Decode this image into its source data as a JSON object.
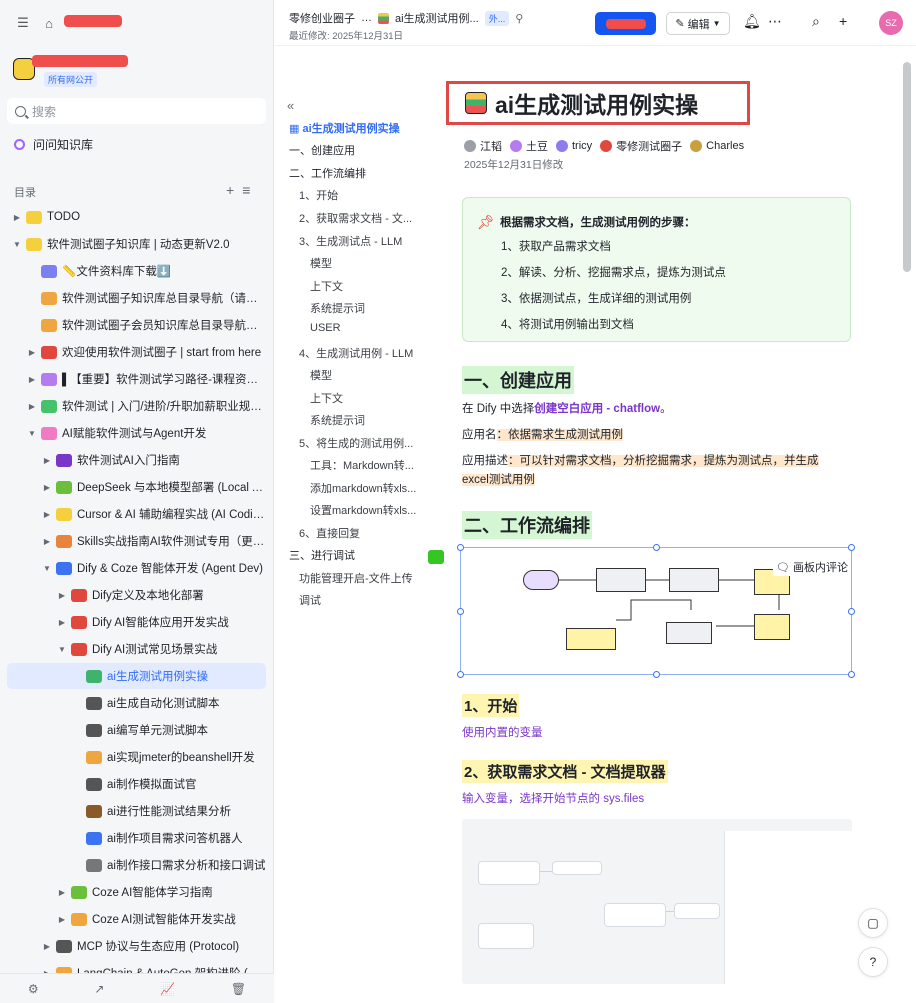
{
  "sidebar": {
    "kb_badge": "所有网公开",
    "search_placeholder": "搜索",
    "ask_label": "问问知识库",
    "toc_label": "目录",
    "tree": [
      {
        "label": "TODO",
        "arrow": "▶",
        "indent": 0,
        "icon_color": "#f4d03f"
      },
      {
        "label": "软件测试圈子知识库 | 动态更新V2.0",
        "arrow": "▼",
        "indent": 0,
        "icon_color": "#f4d03f"
      },
      {
        "label": "📏文件资料库下载⬇️",
        "arrow": "",
        "indent": 1,
        "icon_color": "#7b7ff0"
      },
      {
        "label": "软件测试圈子知识库总目录导航（请收藏...",
        "arrow": "",
        "indent": 1,
        "icon_color": "#f0a640"
      },
      {
        "label": "软件测试圈子会员知识库总目录导航（请...",
        "arrow": "",
        "indent": 1,
        "icon_color": "#f0a640"
      },
      {
        "label": "欢迎使用软件测试圈子 | start from here",
        "arrow": "▶",
        "indent": 1,
        "icon_color": "#e0483e"
      },
      {
        "label": "▌【重要】软件测试学习路径-课程资源下载",
        "arrow": "▶",
        "indent": 1,
        "icon_color": "#b57bf0"
      },
      {
        "label": "软件测试 | 入门/进阶/升职加薪职业规划（...",
        "arrow": "▶",
        "indent": 1,
        "icon_color": "#44c36b"
      },
      {
        "label": "AI赋能软件测试与Agent开发",
        "arrow": "▼",
        "indent": 1,
        "icon_color": "#f07bc4"
      },
      {
        "label": "软件测试AI入门指南",
        "arrow": "▶",
        "indent": 2,
        "icon_color": "#7a35c9"
      },
      {
        "label": "DeepSeek 与本地模型部署 (Local AI)",
        "arrow": "▶",
        "indent": 2,
        "icon_color": "#6cbf3c"
      },
      {
        "label": "Cursor & AI 辅助编程实战 (AI Coding)",
        "arrow": "▶",
        "indent": 2,
        "icon_color": "#f4d03f"
      },
      {
        "label": "Skills实战指南AI软件测试专用（更新中）",
        "arrow": "▶",
        "indent": 2,
        "icon_color": "#e8843c"
      },
      {
        "label": "Dify & Coze 智能体开发 (Agent Dev)",
        "arrow": "▼",
        "indent": 2,
        "icon_color": "#3b73f0"
      },
      {
        "label": "Dify定义及本地化部署",
        "arrow": "▶",
        "indent": 3,
        "icon_color": "#e0483e"
      },
      {
        "label": "Dify AI智能体应用开发实战",
        "arrow": "▶",
        "indent": 3,
        "icon_color": "#e0483e"
      },
      {
        "label": "Dify AI测试常见场景实战",
        "arrow": "▼",
        "indent": 3,
        "icon_color": "#e0483e"
      },
      {
        "label": "ai生成测试用例实操",
        "arrow": "",
        "indent": 4,
        "icon_color": "#3fb36b",
        "selected": true
      },
      {
        "label": "ai生成自动化测试脚本",
        "arrow": "",
        "indent": 4,
        "icon_color": "#555"
      },
      {
        "label": "ai编写单元测试脚本",
        "arrow": "",
        "indent": 4,
        "icon_color": "#555"
      },
      {
        "label": "ai实现jmeter的beanshell开发",
        "arrow": "",
        "indent": 4,
        "icon_color": "#f0a640"
      },
      {
        "label": "ai制作模拟面试官",
        "arrow": "",
        "indent": 4,
        "icon_color": "#555"
      },
      {
        "label": "ai进行性能测试结果分析",
        "arrow": "",
        "indent": 4,
        "icon_color": "#8a5a2b"
      },
      {
        "label": "ai制作项目需求问答机器人",
        "arrow": "",
        "indent": 4,
        "icon_color": "#3b73f0"
      },
      {
        "label": "ai制作接口需求分析和接口调试",
        "arrow": "",
        "indent": 4,
        "icon_color": "#777"
      },
      {
        "label": "Coze AI智能体学习指南",
        "arrow": "▶",
        "indent": 3,
        "icon_color": "#6cbf3c"
      },
      {
        "label": "Coze AI测试智能体开发实战",
        "arrow": "▶",
        "indent": 3,
        "icon_color": "#f0a640"
      },
      {
        "label": "MCP 协议与生态应用 (Protocol)",
        "arrow": "▶",
        "indent": 2,
        "icon_color": "#555"
      },
      {
        "label": "LangChain & AutoGen 架构进阶 (Pro-Fr...",
        "arrow": "▶",
        "indent": 2,
        "icon_color": "#f0a640"
      }
    ],
    "bottom_icons": [
      "⚙",
      "↗",
      "📈",
      "🗑"
    ]
  },
  "header": {
    "crumb_root": "零修创业圈子",
    "crumb_more": "…",
    "crumb_doc": "ai生成测试用例...",
    "crumb_tag": "外...",
    "modified": "最近修改: 2025年12月31日",
    "edit_label": "编辑",
    "avatar_initials": "SZ"
  },
  "outline": {
    "items": [
      {
        "label": "ai生成测试用例实操",
        "level": "title"
      },
      {
        "label": "一、创建应用",
        "level": "l1"
      },
      {
        "label": "二、工作流编排",
        "level": "l1"
      },
      {
        "label": "1、开始",
        "level": "l2"
      },
      {
        "label": "2、获取需求文档 - 文...",
        "level": "l2"
      },
      {
        "label": "3、生成测试点 - LLM",
        "level": "l2"
      },
      {
        "label": "模型",
        "level": "l3"
      },
      {
        "label": "上下文",
        "level": "l3"
      },
      {
        "label": "系统提示词",
        "level": "l3"
      },
      {
        "label": "USER",
        "level": "l3"
      },
      {
        "label": "4、生成测试用例 - LLM",
        "level": "l2"
      },
      {
        "label": "模型",
        "level": "l3"
      },
      {
        "label": "上下文",
        "level": "l3"
      },
      {
        "label": "系统提示词",
        "level": "l3"
      },
      {
        "label": "5、将生成的测试用例...",
        "level": "l2"
      },
      {
        "label": "工具：Markdown转...",
        "level": "l3"
      },
      {
        "label": "添加markdown转xls...",
        "level": "l3"
      },
      {
        "label": "设置markdown转xls...",
        "level": "l3"
      },
      {
        "label": "6、直接回复",
        "level": "l2"
      },
      {
        "label": "三、进行调试",
        "level": "l1"
      },
      {
        "label": "功能管理开启-文件上传",
        "level": "l2"
      },
      {
        "label": "调试",
        "level": "l2"
      }
    ]
  },
  "doc": {
    "title": "ai生成测试用例实操",
    "authors": [
      {
        "name": "江韬",
        "color": "#9aa0a6"
      },
      {
        "name": "土豆",
        "color": "#b57bf0"
      },
      {
        "name": "tricy",
        "color": "#8f7bf0"
      },
      {
        "name": "零修测试圈子",
        "color": "#e0483e"
      },
      {
        "name": "Charles",
        "color": "#c8a040"
      }
    ],
    "date": "2025年12月31日修改",
    "callout_title": "根据需求文档，生成测试用例的步骤：",
    "steps": [
      "1、获取产品需求文档",
      "2、解读、分析、挖掘需求点，提炼为测试点",
      "3、依据测试点，生成详细的测试用例",
      "4、将测试用例输出到文档"
    ],
    "h_create": "一、创建应用",
    "create_pre": "在 Dify 中选择",
    "create_link": "创建空白应用 - chatflow",
    "create_post": "。",
    "app_name_label": "应用名",
    "app_name_value": "：依据需求生成测试用例",
    "app_desc_label": "应用描述",
    "app_desc_value": "：可以针对需求文档，分析挖掘需求，提炼为测试点，并生成",
    "app_desc_value2": "excel测试用例",
    "h_workflow": "二、工作流编排",
    "diagram_comment": "画板内评论",
    "h_start": "1、开始",
    "start_desc": "使用内置的变量",
    "h_fetch": "2、获取需求文档 - 文档提取器",
    "fetch_desc": "输入变量，选择开始节点的 sys.files"
  }
}
